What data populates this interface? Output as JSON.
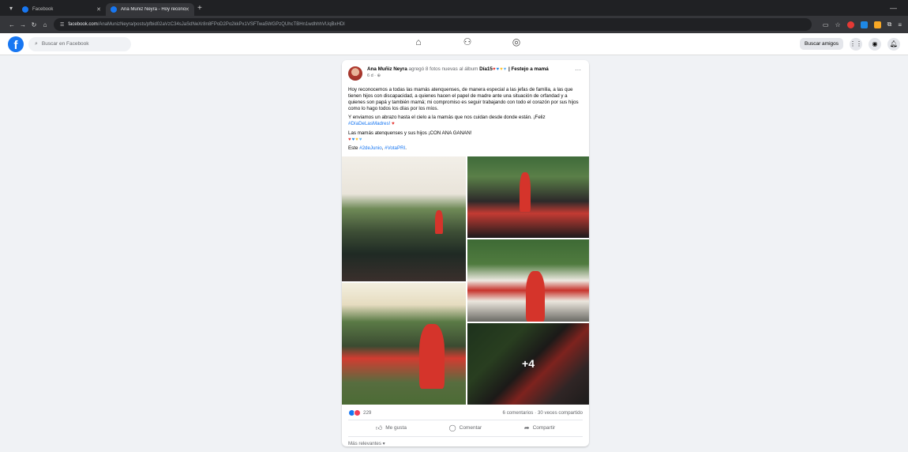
{
  "browser": {
    "tabs": [
      {
        "label": "Facebook"
      },
      {
        "label": "Ana Muñiz Neyra - Hoy reconoc..."
      }
    ],
    "url_host": "facebook.com",
    "url_path": "/AnaMunizNeyra/posts/pfbid02aVzC34sJaSdNeXr8n8FPoD2Po2kkPx1VSFTwa5WGPzQUhcTBHn1wdhhhVUqBxHDl"
  },
  "fb": {
    "search_placeholder": "Buscar en Facebook",
    "find_friends": "Buscar amigos"
  },
  "post": {
    "author": "Ana Muñiz Neyra",
    "action": "agregó 8 fotos nuevas al álbum",
    "album_prefix": "Día15",
    "album_suffix": "| Festejo a mamá",
    "time": "6 d ·",
    "paragraph1": "Hoy reconocemos a todas las mamás atenquenses, de manera especial a las jefas de familia, a las que tienen hijos con discapacidad, a quienes hacen el papel de madre ante una situación de orfandad y a quienes son papá y también mamá; mi compromiso es seguir trabajando con todo el corazón por sus hijos como lo hago todos los días por los míos.",
    "paragraph2_a": "Y enviamos un abrazo hasta el cielo a la mamás que nos cuidan desde donde están. ¡Feliz",
    "paragraph2_tag": "#DíaDeLasMadres!",
    "paragraph3": "Las mamás atenquenses y sus hijos ¡CON ANA GANAN!",
    "paragraph4_a": "Este",
    "tag_date": "#2deJunio",
    "tag_vote": "#VotaPRI",
    "more_photos": "+4",
    "reaction_count": "229",
    "comments_shares": "6 comentarios · 30 veces compartido",
    "like_label": "Me gusta",
    "comment_label": "Comentar",
    "share_label": "Compartir",
    "relevance": "Más relevantes ▾"
  }
}
